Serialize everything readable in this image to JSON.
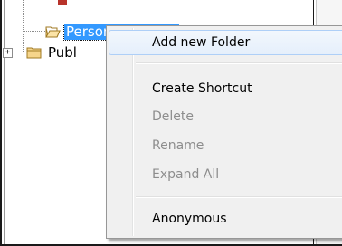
{
  "tree": {
    "top_item_label": "",
    "personal_folders_label": "Personal Folders",
    "public_folders_label": "Publ",
    "expander_symbol": "+",
    "colors": {
      "selection": "#3399ff",
      "folder_fill": "#f6d58b",
      "folder_stroke": "#a07a23"
    }
  },
  "context_menu": {
    "items": [
      {
        "label": "Add new Folder",
        "enabled": true,
        "highlighted": true
      },
      {
        "label": "Create Shortcut",
        "enabled": true
      },
      {
        "label": "Delete",
        "enabled": false
      },
      {
        "label": "Rename",
        "enabled": false
      },
      {
        "label": "Expand All",
        "enabled": false
      },
      {
        "label": "Anonymous",
        "enabled": true
      }
    ]
  },
  "icons": [
    "open-folder-icon",
    "closed-folder-icon",
    "expand-plus-icon"
  ]
}
